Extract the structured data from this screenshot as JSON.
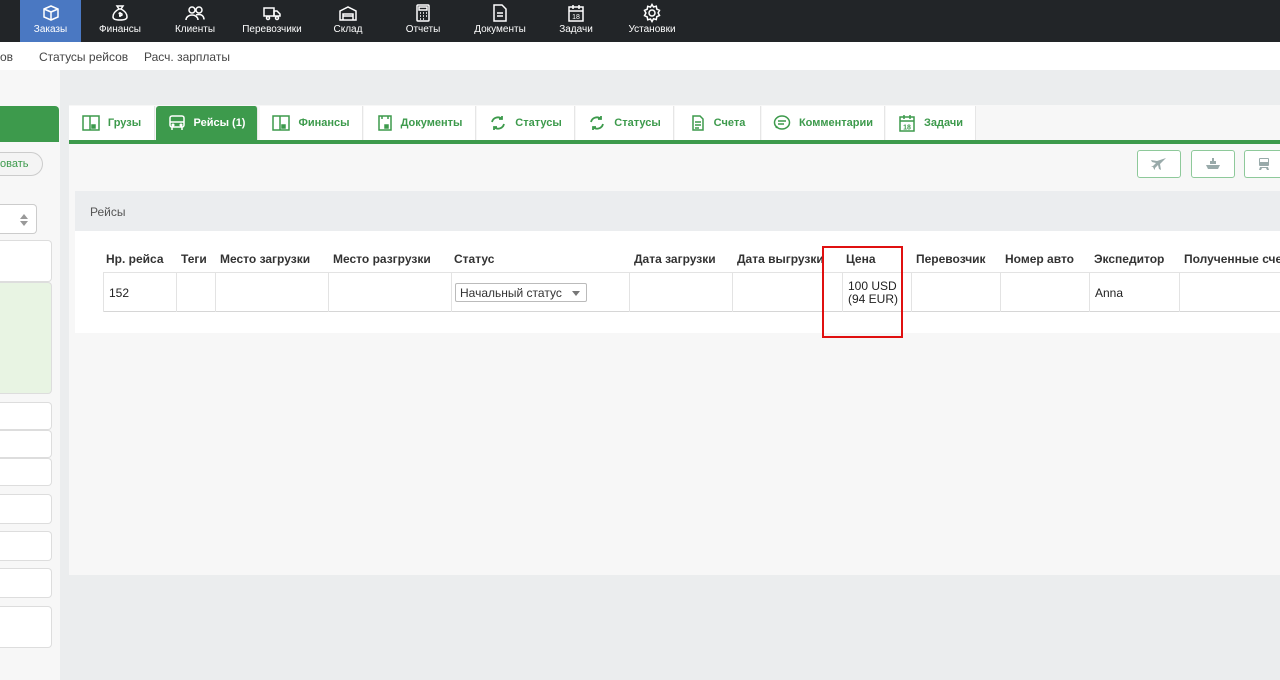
{
  "topnav": {
    "items": [
      {
        "label": "Заказы",
        "icon": "orders-box-icon",
        "active": true
      },
      {
        "label": "Финансы",
        "icon": "money-bag-icon"
      },
      {
        "label": "Клиенты",
        "icon": "clients-people-icon"
      },
      {
        "label": "Перевозчики",
        "icon": "truck-icon"
      },
      {
        "label": "Склад",
        "icon": "warehouse-icon"
      },
      {
        "label": "Отчеты",
        "icon": "calculator-icon"
      },
      {
        "label": "Документы",
        "icon": "document-icon"
      },
      {
        "label": "Задачи",
        "icon": "calendar-icon"
      },
      {
        "label": "Установки",
        "icon": "gear-icon"
      }
    ]
  },
  "subnav": {
    "items": [
      {
        "label": "ов"
      },
      {
        "label": "Статусы рейсов"
      },
      {
        "label": "Расч. зарплаты"
      }
    ]
  },
  "left_panel": {
    "button_label": "овать"
  },
  "tabs": [
    {
      "label": "Грузы",
      "icon": "cargo-icon"
    },
    {
      "label": "Рейсы (1)",
      "icon": "bus-icon",
      "active": true
    },
    {
      "label": "Финансы",
      "icon": "finance-panel-icon"
    },
    {
      "label": "Документы",
      "icon": "documents-icon"
    },
    {
      "label": "Статусы",
      "icon": "refresh-icon"
    },
    {
      "label": "Статусы",
      "icon": "refresh-icon"
    },
    {
      "label": "Счета",
      "icon": "invoice-icon"
    },
    {
      "label": "Комментарии",
      "icon": "comment-icon"
    },
    {
      "label": "Задачи",
      "icon": "calendar-icon"
    }
  ],
  "toolbar": {
    "buttons": [
      {
        "icon": "airplane-icon"
      },
      {
        "icon": "ship-icon"
      },
      {
        "icon": "train-icon"
      }
    ]
  },
  "trips": {
    "title": "Рейсы",
    "columns": [
      "Нр. рейса",
      "Теги",
      "Место загрузки",
      "Место разгрузки",
      "Статус",
      "Дата загрузки",
      "Дата выгрузки",
      "Цена",
      "Перевозчик",
      "Номер авто",
      "Экспедитор",
      "Полученные счета"
    ],
    "rows": [
      {
        "number": "152",
        "tags": "",
        "load_place": "",
        "unload_place": "",
        "status": "Начальный статус",
        "load_date": "",
        "unload_date": "",
        "price_usd": "100 USD",
        "price_eur": "(94 EUR)",
        "carrier": "",
        "plate": "",
        "forwarder": "Anna",
        "invoices": ""
      }
    ]
  },
  "colors": {
    "accent": "#3d9a4c",
    "topnav_bg": "#222528",
    "topnav_active": "#4a78c2",
    "highlight": "#e01010"
  }
}
